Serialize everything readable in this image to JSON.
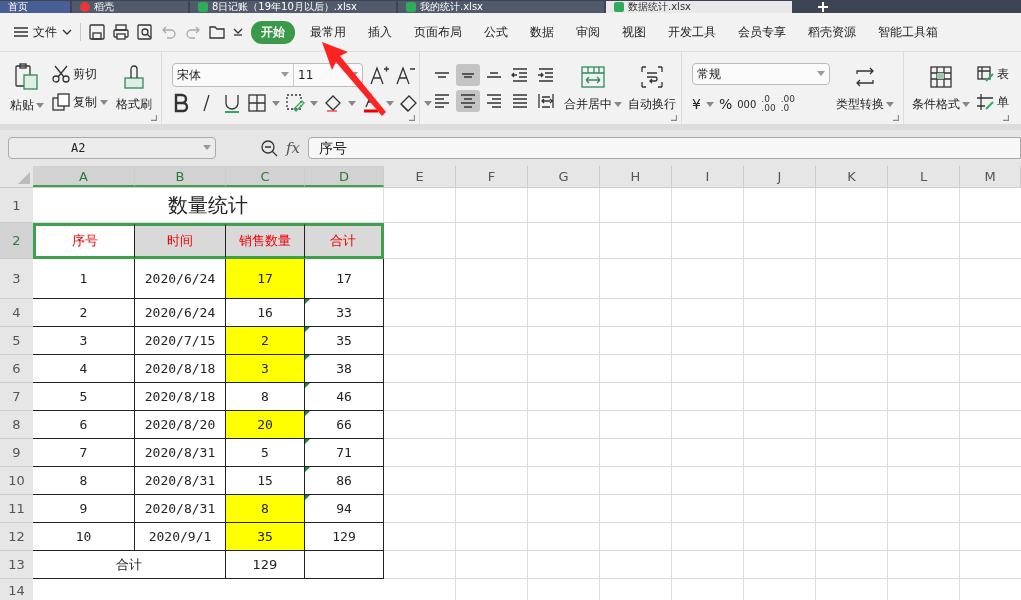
{
  "doc_tabs": [
    {
      "title": "首页",
      "kind": "home",
      "selected": false
    },
    {
      "title": "稻壳",
      "kind": "docer",
      "selected": false
    },
    {
      "title": "8日记账（19年10月以后）.xlsx",
      "kind": "sheet",
      "selected": false
    },
    {
      "title": "我的统计.xlsx",
      "kind": "sheet",
      "selected": false
    },
    {
      "title": "数据统计.xlsx",
      "kind": "sheet",
      "selected": true
    }
  ],
  "menu": {
    "file": "文件",
    "tabs": [
      {
        "label": "开始",
        "selected": true
      },
      {
        "label": "最常用",
        "selected": false
      },
      {
        "label": "插入",
        "selected": false
      },
      {
        "label": "页面布局",
        "selected": false
      },
      {
        "label": "公式",
        "selected": false
      },
      {
        "label": "数据",
        "selected": false
      },
      {
        "label": "审阅",
        "selected": false
      },
      {
        "label": "视图",
        "selected": false
      },
      {
        "label": "开发工具",
        "selected": false
      },
      {
        "label": "会员专享",
        "selected": false
      },
      {
        "label": "稻壳资源",
        "selected": false
      },
      {
        "label": "智能工具箱",
        "selected": false
      }
    ]
  },
  "ribbon": {
    "paste": "粘贴",
    "cut": "剪切",
    "copy": "复制",
    "format_painter": "格式刷",
    "font_name": "宋体",
    "font_size": "11",
    "align_buttons": [
      {
        "kind": "top",
        "selected": false
      },
      {
        "kind": "middle",
        "selected": true
      },
      {
        "kind": "bottom",
        "selected": false
      },
      {
        "kind": "outdent",
        "selected": false
      },
      {
        "kind": "indent",
        "selected": false
      },
      {
        "kind": "left",
        "selected": false
      },
      {
        "kind": "center",
        "selected": true
      },
      {
        "kind": "right",
        "selected": false
      },
      {
        "kind": "justify",
        "selected": false
      },
      {
        "kind": "distribute",
        "selected": false
      }
    ],
    "merge": "合并居中",
    "wrap": "自动换行",
    "number_format": "常规",
    "currency": "¥",
    "percent": "%",
    "thousands": "000",
    "decimal_more": [
      ".0",
      ".00"
    ],
    "decimal_less": [
      ".00",
      ".0"
    ],
    "convert": "类型转换",
    "conditional": "条件格式",
    "table_style": "表",
    "cell_style": "单"
  },
  "formula_bar": {
    "name_box": "A2",
    "fx": "fx",
    "value": "序号"
  },
  "columns": [
    {
      "label": "A",
      "selected": true
    },
    {
      "label": "B",
      "selected": true
    },
    {
      "label": "C",
      "selected": true
    },
    {
      "label": "D",
      "selected": true
    },
    {
      "label": "E",
      "selected": false
    },
    {
      "label": "F",
      "selected": false
    },
    {
      "label": "G",
      "selected": false
    },
    {
      "label": "H",
      "selected": false
    },
    {
      "label": "I",
      "selected": false
    },
    {
      "label": "J",
      "selected": false
    },
    {
      "label": "K",
      "selected": false
    },
    {
      "label": "L",
      "selected": false
    },
    {
      "label": "M",
      "selected": false
    }
  ],
  "rows": [
    {
      "number": "1",
      "kind": "title",
      "selected": false,
      "cells": [
        {
          "text": "数量统计",
          "flag": false
        }
      ]
    },
    {
      "number": "2",
      "kind": "header",
      "selected": true,
      "cells": [
        {
          "text": "序号",
          "flag": false
        },
        {
          "text": "时间",
          "color": "#d9d9d9",
          "flag": false
        },
        {
          "text": "销售数量",
          "color": "#d9d9d9",
          "flag": false
        },
        {
          "text": "合计",
          "color": "#d9d9d9",
          "flag": false
        }
      ]
    },
    {
      "number": "3",
      "kind": "data",
      "selected": false,
      "cells": [
        {
          "text": "1",
          "flag": false
        },
        {
          "text": "2020/6/24",
          "flag": false
        },
        {
          "text": "17",
          "color": "#ffff00",
          "flag": false
        },
        {
          "text": "17",
          "flag": false
        }
      ]
    },
    {
      "number": "4",
      "kind": "data",
      "selected": false,
      "cells": [
        {
          "text": "2",
          "flag": false
        },
        {
          "text": "2020/6/24",
          "flag": false
        },
        {
          "text": "16",
          "flag": false
        },
        {
          "text": "33",
          "flag": true
        }
      ]
    },
    {
      "number": "5",
      "kind": "data",
      "selected": false,
      "cells": [
        {
          "text": "3",
          "flag": false
        },
        {
          "text": "2020/7/15",
          "flag": false
        },
        {
          "text": "2",
          "color": "#ffff00",
          "flag": false
        },
        {
          "text": "35",
          "flag": true
        }
      ]
    },
    {
      "number": "6",
      "kind": "data",
      "selected": false,
      "cells": [
        {
          "text": "4",
          "flag": false
        },
        {
          "text": "2020/8/18",
          "flag": false
        },
        {
          "text": "3",
          "color": "#ffff00",
          "flag": false
        },
        {
          "text": "38",
          "flag": true
        }
      ]
    },
    {
      "number": "7",
      "kind": "data",
      "selected": false,
      "cells": [
        {
          "text": "5",
          "flag": false
        },
        {
          "text": "2020/8/18",
          "flag": false
        },
        {
          "text": "8",
          "flag": false
        },
        {
          "text": "46",
          "flag": true
        }
      ]
    },
    {
      "number": "8",
      "kind": "data",
      "selected": false,
      "cells": [
        {
          "text": "6",
          "flag": false
        },
        {
          "text": "2020/8/20",
          "flag": false
        },
        {
          "text": "20",
          "color": "#ffff00",
          "flag": false
        },
        {
          "text": "66",
          "flag": true
        }
      ]
    },
    {
      "number": "9",
      "kind": "data",
      "selected": false,
      "cells": [
        {
          "text": "7",
          "flag": false
        },
        {
          "text": "2020/8/31",
          "flag": false
        },
        {
          "text": "5",
          "flag": false
        },
        {
          "text": "71",
          "flag": true
        }
      ]
    },
    {
      "number": "10",
      "kind": "data",
      "selected": false,
      "cells": [
        {
          "text": "8",
          "flag": false
        },
        {
          "text": "2020/8/31",
          "flag": false
        },
        {
          "text": "15",
          "flag": false
        },
        {
          "text": "86",
          "flag": true
        }
      ]
    },
    {
      "number": "11",
      "kind": "data",
      "selected": false,
      "cells": [
        {
          "text": "9",
          "flag": false
        },
        {
          "text": "2020/8/31",
          "flag": false
        },
        {
          "text": "8",
          "color": "#ffff00",
          "flag": false
        },
        {
          "text": "94",
          "flag": true
        }
      ]
    },
    {
      "number": "12",
      "kind": "data",
      "selected": false,
      "cells": [
        {
          "text": "10",
          "flag": false
        },
        {
          "text": "2020/9/1",
          "flag": false
        },
        {
          "text": "35",
          "color": "#ffff00",
          "flag": false
        },
        {
          "text": "129",
          "flag": false
        }
      ]
    },
    {
      "number": "13",
      "kind": "total",
      "selected": false,
      "cells": [
        {
          "text": "合计",
          "flag": false
        },
        {
          "text": "129",
          "flag": false
        }
      ]
    },
    {
      "number": "14",
      "kind": "empty",
      "selected": false,
      "cells": []
    }
  ]
}
